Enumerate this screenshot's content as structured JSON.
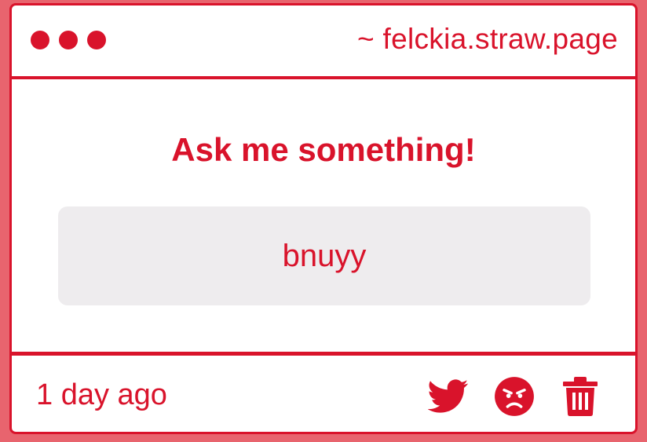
{
  "window": {
    "site_label": "~ felckia.straw.page"
  },
  "main": {
    "heading": "Ask me something!",
    "question": "bnuyy"
  },
  "footer": {
    "timestamp": "1 day ago",
    "actions": [
      {
        "icon": "twitter-bird-icon"
      },
      {
        "icon": "angry-face-icon"
      },
      {
        "icon": "trash-icon"
      }
    ]
  },
  "colors": {
    "accent": "#d9132b",
    "background": "#e8646e",
    "question_bg": "#eeecee"
  }
}
